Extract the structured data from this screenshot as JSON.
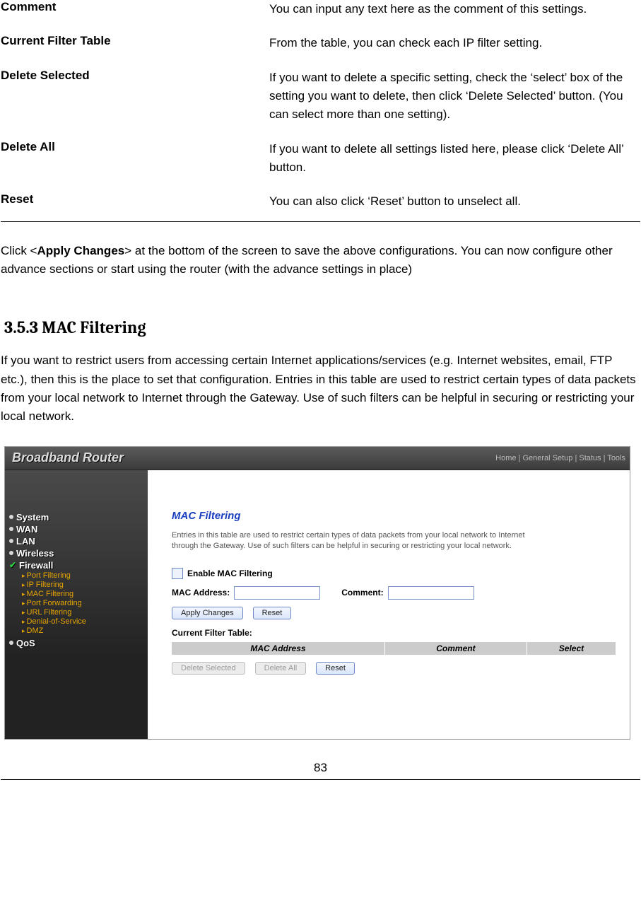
{
  "definitions": [
    {
      "term": "Comment",
      "desc": "You can input any text here as the comment of this settings."
    },
    {
      "term": "Current Filter Table",
      "desc": "From the table, you can check each IP filter setting."
    },
    {
      "term": "Delete Selected",
      "desc": "If you want to delete a specific setting, check the ‘select’ box of the setting you want to delete, then click ‘Delete Selected’ button. (You can select more than one setting)."
    },
    {
      "term": "Delete All",
      "desc": "If you want to delete all settings listed here, please click ‘Delete All’ button."
    },
    {
      "term": "Reset",
      "desc": "You can also click ‘Reset’ button to unselect all."
    }
  ],
  "apply_para_pre": "Click <",
  "apply_para_bold": "Apply Changes",
  "apply_para_post": "> at the bottom of the screen to save the above configurations. You can now configure other advance sections or start using the router (with the advance settings in place)",
  "section_heading": "3.5.3 MAC Filtering",
  "section_body": "If you want to restrict users from accessing certain Internet applications/services (e.g. Internet websites, email, FTP etc.), then this is the place to set that configuration. Entries in this table are used to restrict certain types of data packets from your local network to Internet through the Gateway. Use of such filters can be helpful in securing or restricting your local network.",
  "page_number": "83",
  "router": {
    "brand": "Broadband Router",
    "top_nav": "Home | General Setup | Status | Tools",
    "sidebar": {
      "items": [
        "System",
        "WAN",
        "LAN",
        "Wireless",
        "Firewall",
        "QoS"
      ],
      "sub": [
        "Port Filtering",
        "IP Filtering",
        "MAC Filtering",
        "Port Forwarding",
        "URL Filtering",
        "Denial-of-Service",
        "DMZ"
      ]
    },
    "panel": {
      "title": "MAC Filtering",
      "desc": "Entries in this table are used to restrict certain types of data packets from your local network to Internet through the Gateway. Use of such filters can be helpful in securing or restricting your local network.",
      "enable_label": "Enable MAC Filtering",
      "mac_label": "MAC Address:",
      "comment_label": "Comment:",
      "apply_btn": "Apply Changes",
      "reset_btn": "Reset",
      "table_caption": "Current Filter Table:",
      "th_mac": "MAC Address",
      "th_comment": "Comment",
      "th_select": "Select",
      "del_sel_btn": "Delete Selected",
      "del_all_btn": "Delete All",
      "reset2_btn": "Reset"
    }
  }
}
